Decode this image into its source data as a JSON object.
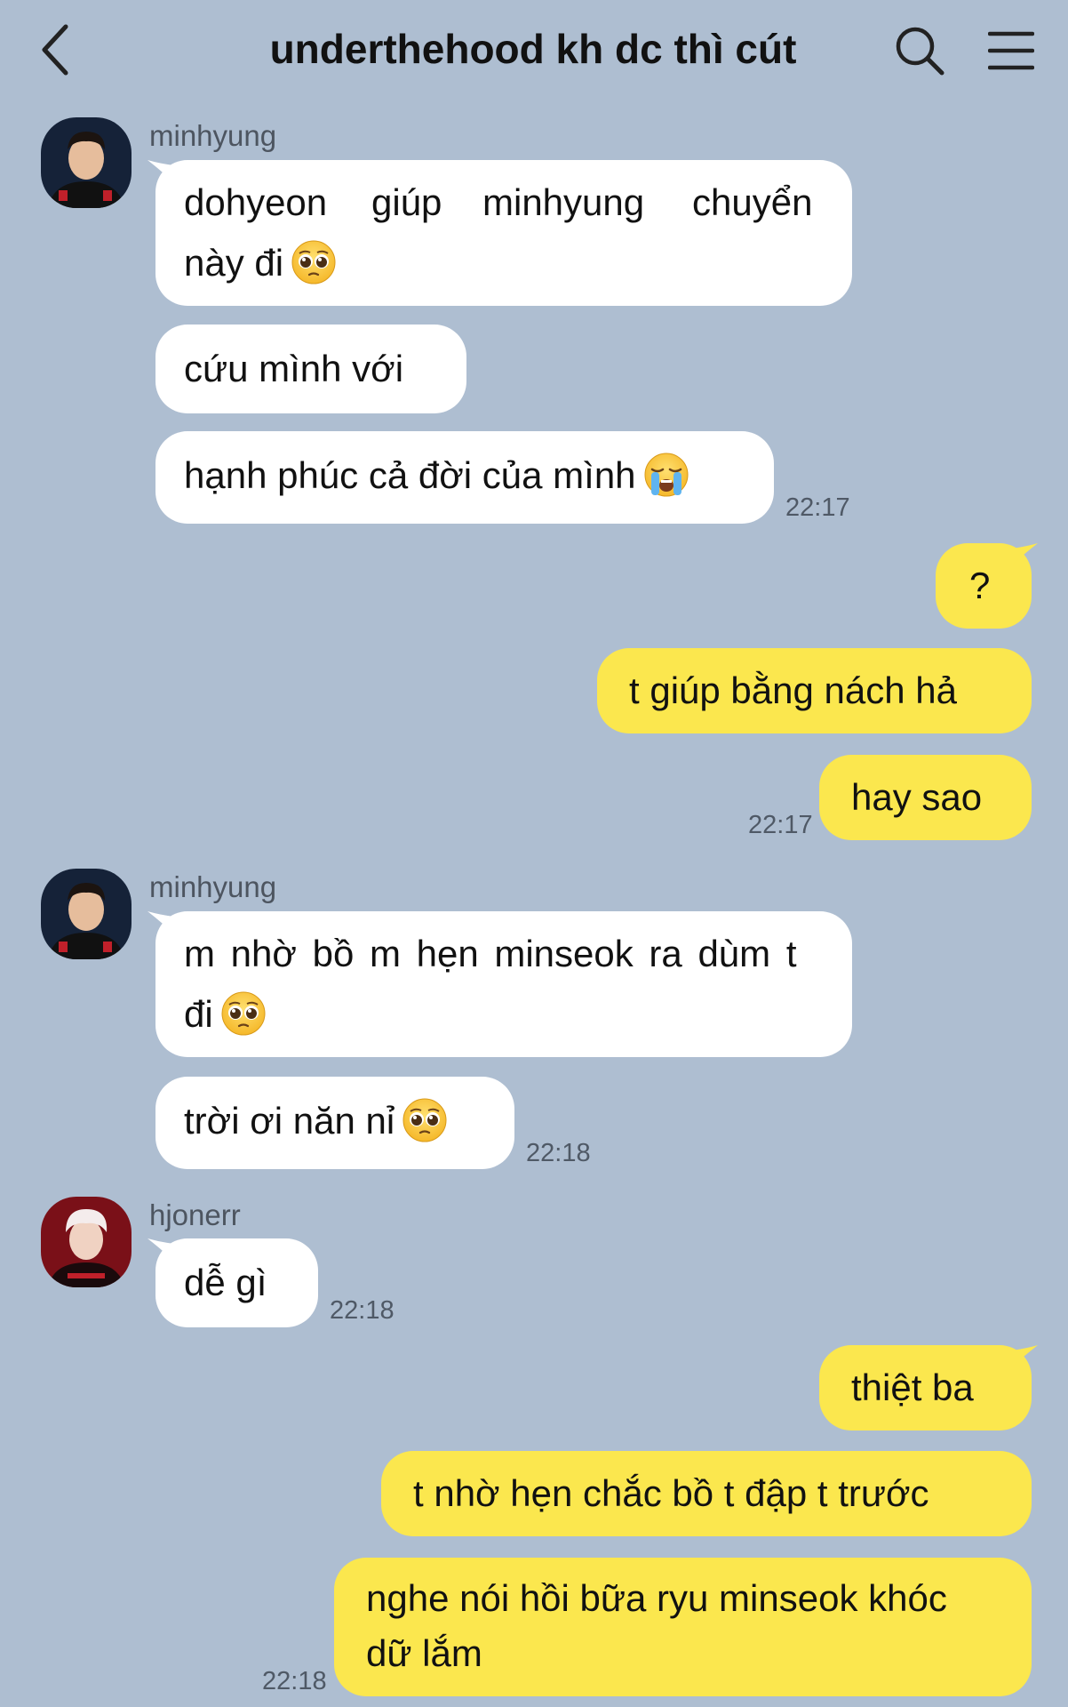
{
  "header": {
    "title": "underthehood kh dc thì cút"
  },
  "messages": {
    "m1": {
      "sender": "minhyung",
      "line1a": "dohyeon",
      "line1b": "giúp",
      "line1c": "minhyung",
      "line1d": "chuyển",
      "line2": "này đi",
      "emoji": "pleading-face-icon"
    },
    "m2": {
      "text": "cứu mình với"
    },
    "m3": {
      "text": "hạnh phúc cả đời của mình",
      "emoji": "loudly-crying-face-icon",
      "time": "22:17"
    },
    "m4": {
      "text": "?"
    },
    "m5": {
      "text": "t giúp bằng nách hả"
    },
    "m6": {
      "text": "hay sao",
      "time": "22:17"
    },
    "m7": {
      "sender": "minhyung",
      "line1": "m nhờ bồ m hẹn minseok ra dùm t",
      "line2": "đi",
      "emoji": "pleading-face-icon"
    },
    "m8": {
      "text": "trời ơi năn nỉ",
      "emoji": "pleading-face-icon",
      "time": "22:18"
    },
    "m9": {
      "sender": "hjonerr",
      "text": "dễ gì",
      "time": "22:18"
    },
    "m10": {
      "text": "thiệt ba"
    },
    "m11": {
      "text": "t nhờ hẹn chắc bồ t đập t trước"
    },
    "m12": {
      "line1": "nghe nói hồi bữa ryu minseok khóc",
      "line2": "dữ lắm",
      "time": "22:18"
    }
  },
  "colors": {
    "background": "#aebed1",
    "incoming_bubble": "#ffffff",
    "outgoing_bubble": "#fbe74e"
  }
}
